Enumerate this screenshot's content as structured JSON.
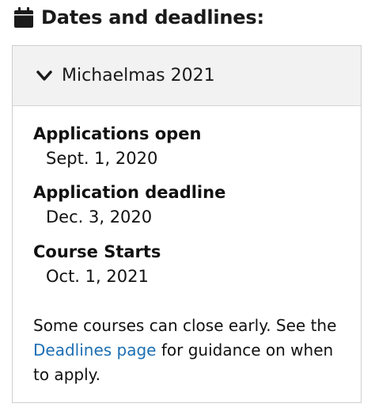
{
  "section": {
    "icon": "calendar-icon",
    "title": "Dates and deadlines:"
  },
  "accordion": {
    "icon": "chevron-down-icon",
    "term": "Michaelmas 2021",
    "expanded": true
  },
  "dates": [
    {
      "label": "Applications open",
      "value": "Sept. 1, 2020"
    },
    {
      "label": "Application deadline",
      "value": "Dec. 3, 2020"
    },
    {
      "label": "Course Starts",
      "value": "Oct. 1, 2021"
    }
  ],
  "note": {
    "before": "Some courses can close early. See the ",
    "link": "Deadlines page",
    "after": " for guidance on when to apply."
  },
  "colors": {
    "link": "#1d6fb3",
    "header_bg": "#f2f2f2",
    "border": "#cfcfcf"
  }
}
